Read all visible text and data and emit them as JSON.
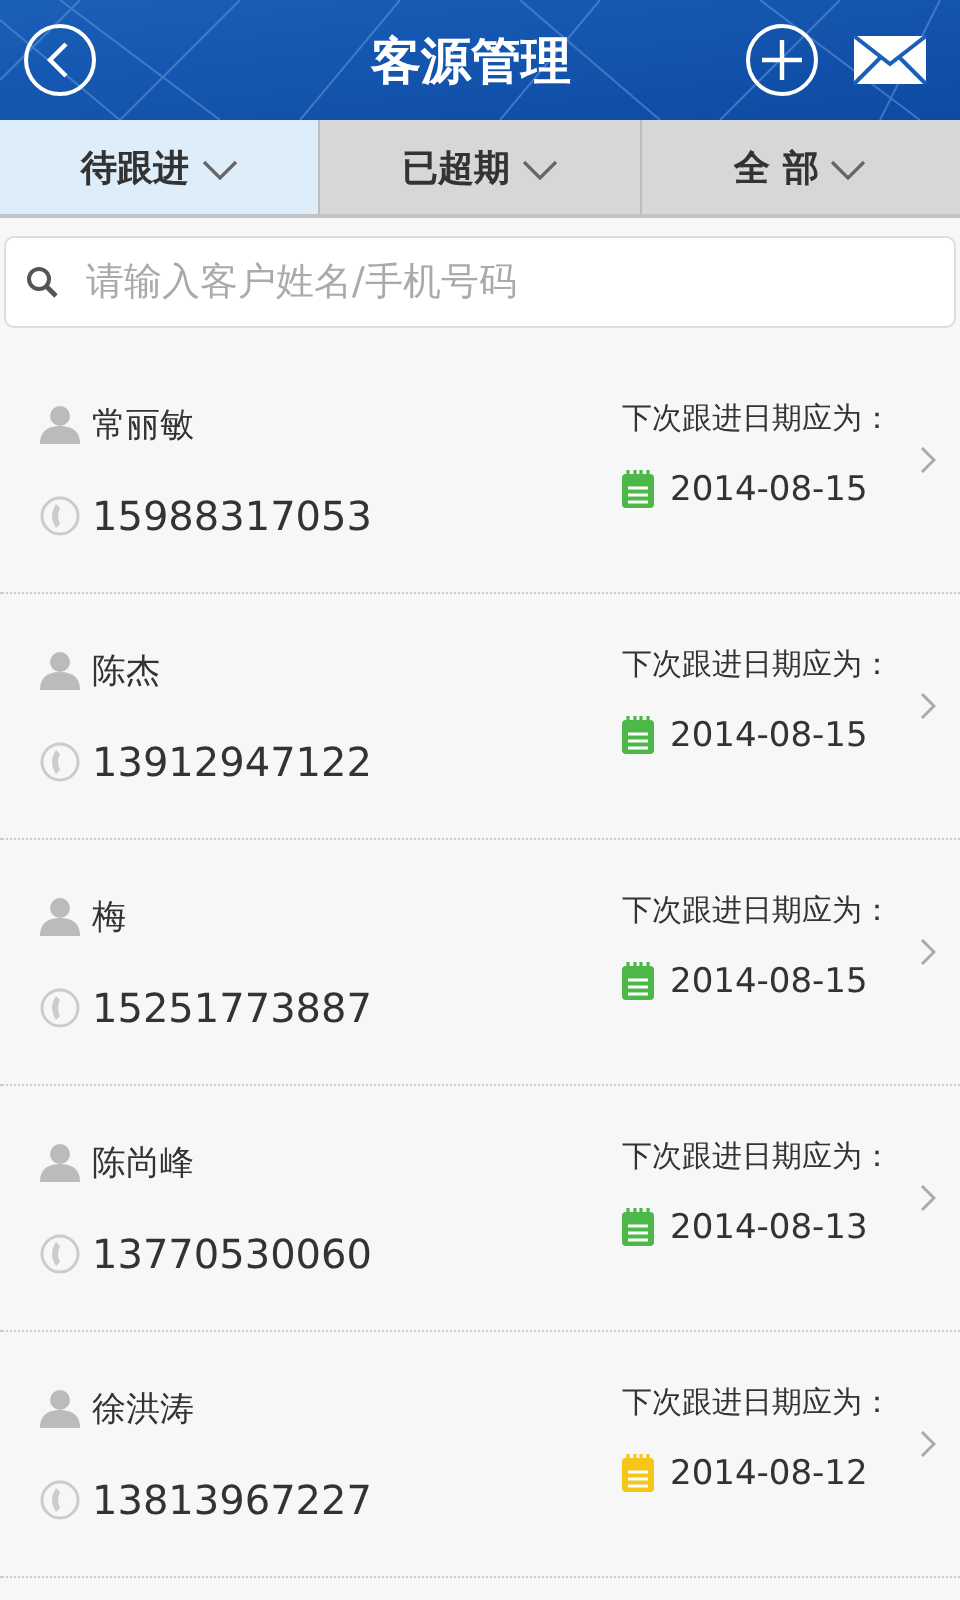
{
  "header": {
    "title": "客源管理"
  },
  "tabs": [
    {
      "label": "待跟进",
      "selected": true
    },
    {
      "label": "已超期",
      "selected": false
    },
    {
      "label": "全 部",
      "selected": false
    }
  ],
  "search": {
    "placeholder": "请输入客户姓名/手机号码"
  },
  "clients": [
    {
      "name": "常丽敏",
      "phone": "15988317053",
      "date_label": "下次跟进日期应为：",
      "date": "2014-08-15",
      "color": "#4cb848"
    },
    {
      "name": "陈杰",
      "phone": "13912947122",
      "date_label": "下次跟进日期应为：",
      "date": "2014-08-15",
      "color": "#4cb848"
    },
    {
      "name": "梅",
      "phone": "15251773887",
      "date_label": "下次跟进日期应为：",
      "date": "2014-08-15",
      "color": "#4cb848"
    },
    {
      "name": "陈尚峰",
      "phone": "13770530060",
      "date_label": "下次跟进日期应为：",
      "date": "2014-08-13",
      "color": "#4cb848"
    },
    {
      "name": "徐洪涛",
      "phone": "13813967227",
      "date_label": "下次跟进日期应为：",
      "date": "2014-08-12",
      "color": "#f5c518"
    }
  ]
}
